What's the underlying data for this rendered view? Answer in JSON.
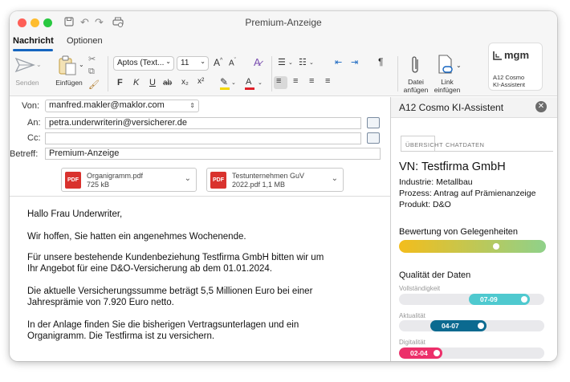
{
  "window": {
    "title": "Premium-Anzeige"
  },
  "ribbon": {
    "tabs": [
      "Nachricht",
      "Optionen"
    ],
    "send_label": "Senden",
    "paste_label": "Einfügen",
    "font_name": "Aptos (Text...",
    "font_size": "11",
    "bold": "F",
    "italic": "K",
    "underline": "U",
    "strike": "ab",
    "subscript": "x₂",
    "superscript": "x²",
    "attach_file_label": [
      "Datei",
      "anfügen"
    ],
    "attach_link_label": [
      "Link",
      "einfügen"
    ],
    "addin": {
      "logo": "mgm",
      "label": [
        "A12 Cosmo",
        "KI-Assistent"
      ]
    }
  },
  "email": {
    "from_label": "Von:",
    "from_value": "manfred.makler@maklor.com",
    "to_label": "An:",
    "to_value": "petra.underwriterin@versicherer.de",
    "cc_label": "Cc:",
    "cc_value": "",
    "subject_label": "Betreff:",
    "subject_value": "Premium-Anzeige",
    "attachments": [
      {
        "name": "Organigramm.pdf",
        "size": "725 kB",
        "icon": "pdf-icon"
      },
      {
        "name": "Testunternehmen GuV",
        "size": "2022.pdf 1,1 MB",
        "icon": "pdf-icon"
      }
    ],
    "body": [
      "Hallo Frau Underwriter,",
      "Wir hoffen, Sie hatten ein angenehmes Wochenende.",
      "Für unsere bestehende Kundenbeziehung Testfirma GmbH bitten wir um Ihr Angebot für eine D&O-Versicherung ab dem 01.01.2024.",
      "Die aktuelle Versicherungssumme beträgt 5,5 Millionen Euro bei einer Jahresprämie von 7.920 Euro netto.",
      "In der Anlage finden Sie die bisherigen Vertragsunterlagen und ein Organigramm. Die Testfirma ist zu versichern."
    ]
  },
  "panel": {
    "title": "A12 Cosmo KI-Assistent",
    "tabs": [
      "ÜBERSICHT",
      "CHATDATEN"
    ],
    "company": "VN: Testfirma GmbH",
    "details": [
      "Industrie: Metallbau",
      "Prozess: Antrag auf Prämienanzeige",
      "Produkt: D&O"
    ],
    "opportunity": {
      "title": "Bewertung von Gelegenheiten",
      "level": 0.66
    },
    "quality_title": "Qualität der Daten",
    "quality": [
      {
        "label": "Vollständigkeit",
        "value": "07-09",
        "color": "#4fc9cf",
        "level": 0.9
      },
      {
        "label": "Aktualität",
        "value": "04-07",
        "color": "#0b6a90",
        "level": 0.6
      },
      {
        "label": "Digitalität",
        "value": "02-04",
        "color": "#ec2f6a",
        "level": 0.3
      }
    ],
    "colors": {
      "gradient_start": "#f3bd1c",
      "gradient_end": "#8fd18a"
    }
  }
}
